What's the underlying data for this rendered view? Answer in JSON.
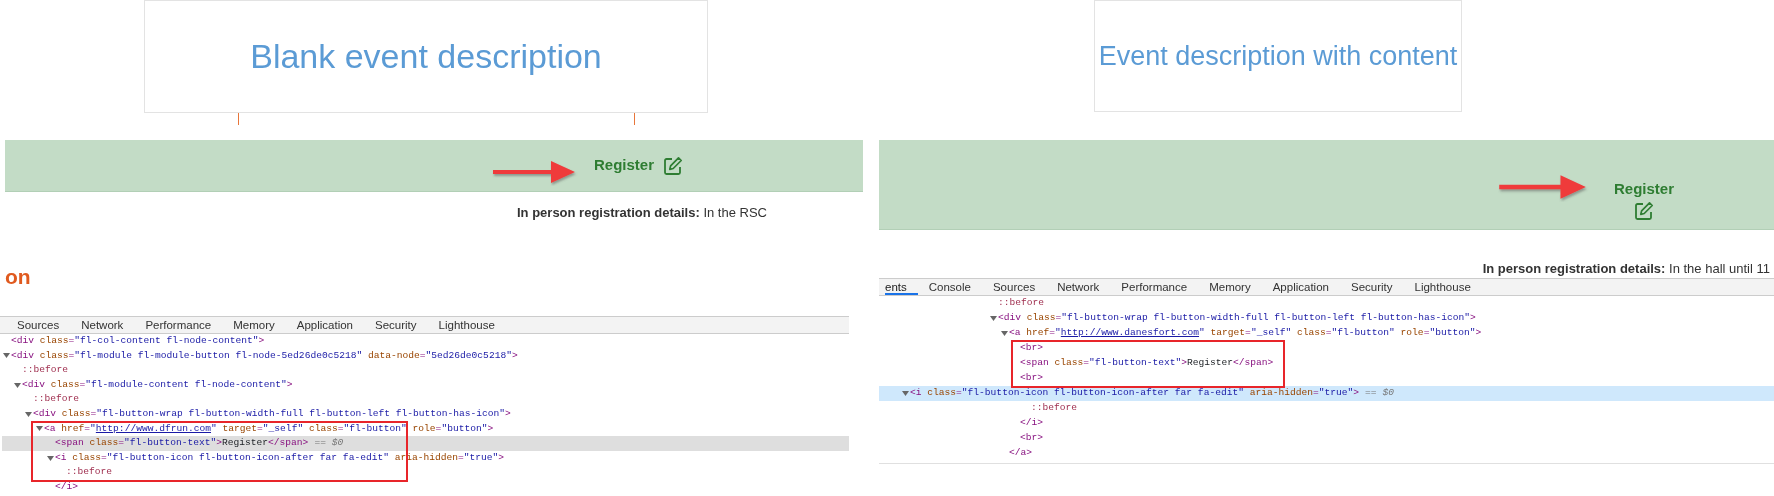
{
  "panels": [
    {
      "heading": "Blank event description",
      "button": {
        "label": "Register",
        "kind": "inline"
      },
      "details": "**In person registration details:** In the RSC",
      "section_heading": "on",
      "devtools": {
        "focused": false,
        "tabs": [
          {
            "label": "Sources",
            "selected": false
          },
          {
            "label": "Network",
            "selected": false
          },
          {
            "label": "Performance",
            "selected": false
          },
          {
            "label": "Memory",
            "selected": false
          },
          {
            "label": "Application",
            "selected": false
          },
          {
            "label": "Security",
            "selected": false
          },
          {
            "label": "Lighthouse",
            "selected": false
          }
        ],
        "lines": [
          {
            "text": "<div class=\"fl-col-content fl-node-content\">",
            "selected": false
          },
          {
            "text": "<div class=\"fl-module fl-module-button fl-node-5ed26de0c5218\" data-node=\"5ed26de0c5218\">",
            "selected": false,
            "expanded": true,
            "children": [
              {
                "text": "::before",
                "selected": false
              },
              {
                "text": "<div class=\"fl-module-content fl-node-content\">",
                "selected": false,
                "expanded": true,
                "children": [
                  {
                    "text": "::before",
                    "selected": false
                  },
                  {
                    "text": "<div class=\"fl-button-wrap fl-button-width-full fl-button-left fl-button-has-icon\">",
                    "selected": false,
                    "expanded": true,
                    "children": [
                      {
                        "text": "<a href=\"http://www.dfrun.com\" target=\"_self\" class=\"fl-button\" role=\"button\">",
                        "selected": false,
                        "link": true,
                        "expanded": true,
                        "children": [
                          {
                            "text": "<span class=\"fl-button-text\">Register</span>",
                            "selected": true,
                            "marker": "== $0"
                          },
                          {
                            "text": "<i class=\"fl-button-icon fl-button-icon-after far fa-edit\" aria-hidden=\"true\">",
                            "selected": false,
                            "expanded": true,
                            "children": [
                              {
                                "text": "::before",
                                "selected": false
                              }
                            ]
                          },
                          {
                            "text": "</i>",
                            "selected": false
                          }
                        ]
                      }
                    ]
                  }
                ]
              }
            ]
          }
        ]
      }
    },
    {
      "heading": "Event description with content",
      "button": {
        "label": "Register",
        "kind": "stacked"
      },
      "details": "**In person registration details:** In the hall until 11",
      "devtools": {
        "focused": true,
        "tabs": [
          {
            "label": "ents",
            "selected": true
          },
          {
            "label": "Console",
            "selected": false
          },
          {
            "label": "Sources",
            "selected": false
          },
          {
            "label": "Network",
            "selected": false
          },
          {
            "label": "Performance",
            "selected": false
          },
          {
            "label": "Memory",
            "selected": false
          },
          {
            "label": "Application",
            "selected": false
          },
          {
            "label": "Security",
            "selected": false
          },
          {
            "label": "Lighthouse",
            "selected": false
          }
        ],
        "lines": [
          {
            "text": "::before",
            "selected": false
          },
          {
            "text": "<div class=\"fl-button-wrap fl-button-width-full fl-button-left fl-button-has-icon\">",
            "selected": false,
            "expanded": true,
            "children": [
              {
                "text": "<a href=\"http://www.danesfort.com\" target=\"_self\" class=\"fl-button\" role=\"button\">",
                "selected": false,
                "link": true,
                "expanded": true,
                "children": [
                  {
                    "text": "<br>",
                    "selected": false
                  },
                  {
                    "text": "<span class=\"fl-button-text\">Register</span>",
                    "selected": false
                  },
                  {
                    "text": "<br>",
                    "selected": false
                  },
                  {
                    "text": "<i class=\"fl-button-icon fl-button-icon-after far fa-edit\" aria-hidden=\"true\">",
                    "selected": true,
                    "marker": "== $0",
                    "expanded": true,
                    "children": [
                      {
                        "text": "::before",
                        "selected": false
                      }
                    ]
                  },
                  {
                    "text": "</i>",
                    "selected": false
                  },
                  {
                    "text": "<br>",
                    "selected": false
                  }
                ]
              },
              {
                "text": "</a>",
                "selected": false
              }
            ]
          }
        ]
      }
    }
  ]
}
